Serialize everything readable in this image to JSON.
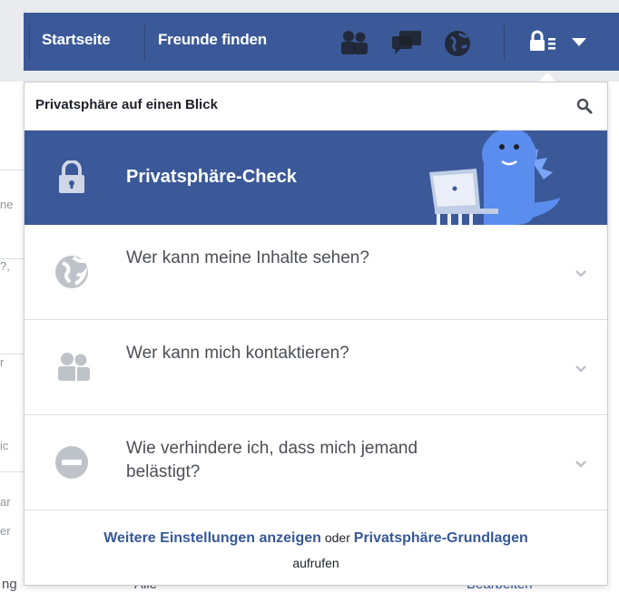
{
  "topbar": {
    "nav_home": "Startseite",
    "nav_find_friends": "Freunde finden",
    "icons": [
      "friend-requests-icon",
      "messages-icon",
      "notifications-globe-icon",
      "privacy-shortcuts-icon",
      "account-menu-chevron-icon"
    ],
    "brand_color": "#3b5998"
  },
  "panel": {
    "title": "Privatsphäre auf einen Blick",
    "search_icon": "search-icon",
    "check": {
      "label": "Privatsphäre-Check",
      "icon": "lock-icon"
    },
    "rows": [
      {
        "text": "Wer kann meine Inhalte sehen?",
        "icon": "globe-icon"
      },
      {
        "text": "Wer kann mich kontaktieren?",
        "icon": "people-icon"
      },
      {
        "text": "Wie verhindere ich, dass mich jemand belästigt?",
        "icon": "block-icon"
      }
    ],
    "footer": {
      "link1": "Weitere Einstellungen anzeigen",
      "connector": " oder ",
      "link2": "Privatsphäre-Grundlagen",
      "suffix": "aufrufen"
    }
  },
  "background": {
    "fragments": [
      "ne",
      "?,",
      "r",
      "ic",
      "ar",
      "er"
    ],
    "bottom_left": "ng",
    "bottom_mid": "Alle",
    "bottom_right": "Bearbeiten"
  },
  "colors": {
    "link": "#365899",
    "banner": "#3b5998",
    "text": "#4b4f56",
    "icon_gray": "#bec3c9"
  }
}
